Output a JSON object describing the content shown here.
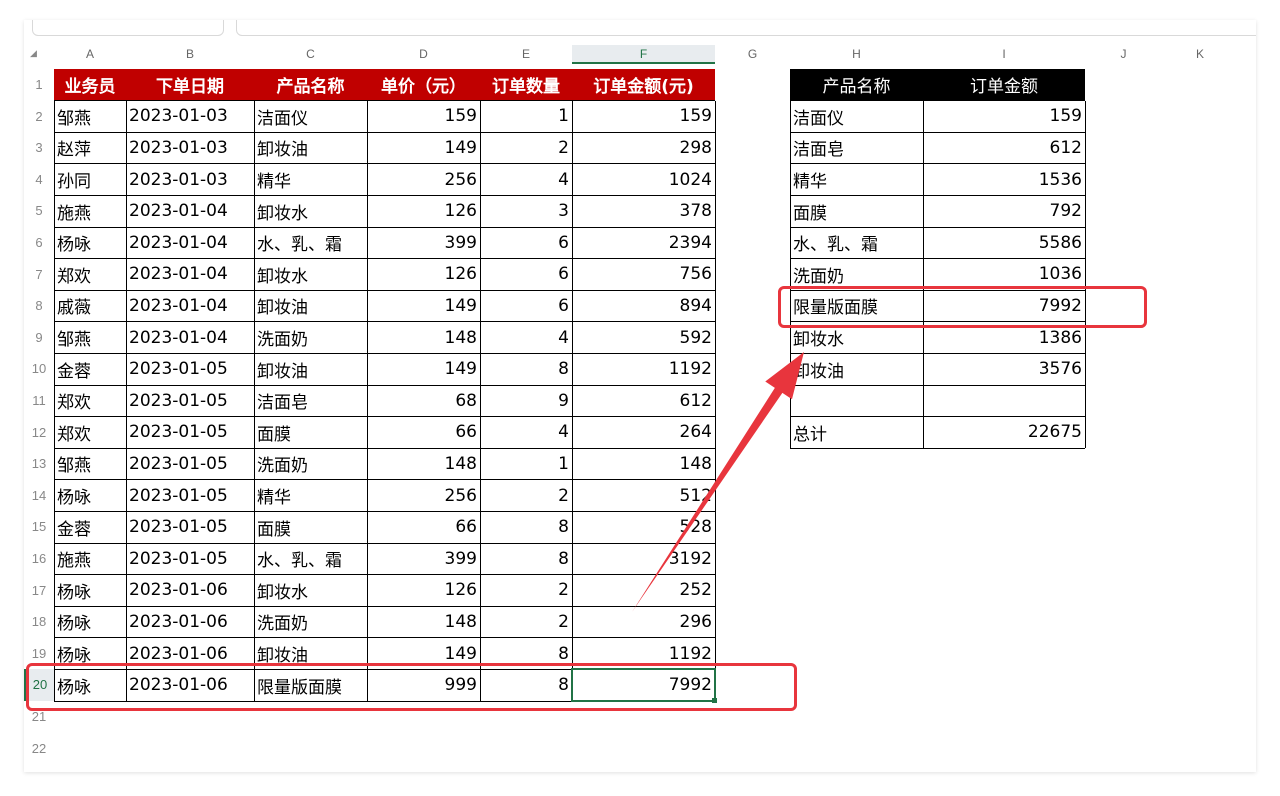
{
  "columns": [
    "A",
    "B",
    "C",
    "D",
    "E",
    "F",
    "G",
    "H",
    "I",
    "J",
    "K"
  ],
  "row_numbers": [
    "1",
    "2",
    "3",
    "4",
    "5",
    "6",
    "7",
    "8",
    "9",
    "10",
    "11",
    "12",
    "13",
    "14",
    "15",
    "16",
    "17",
    "18",
    "19",
    "20",
    "21",
    "22"
  ],
  "main_table": {
    "headers": [
      "业务员",
      "下单日期",
      "产品名称",
      "单价（元）",
      "订单数量",
      "订单金额(元)"
    ],
    "rows": [
      [
        "邹燕",
        "2023-01-03",
        "洁面仪",
        "159",
        "1",
        "159"
      ],
      [
        "赵萍",
        "2023-01-03",
        "卸妆油",
        "149",
        "2",
        "298"
      ],
      [
        "孙同",
        "2023-01-03",
        "精华",
        "256",
        "4",
        "1024"
      ],
      [
        "施燕",
        "2023-01-04",
        "卸妆水",
        "126",
        "3",
        "378"
      ],
      [
        "杨咏",
        "2023-01-04",
        "水、乳、霜",
        "399",
        "6",
        "2394"
      ],
      [
        "郑欢",
        "2023-01-04",
        "卸妆水",
        "126",
        "6",
        "756"
      ],
      [
        "戚薇",
        "2023-01-04",
        "卸妆油",
        "149",
        "6",
        "894"
      ],
      [
        "邹燕",
        "2023-01-04",
        "洗面奶",
        "148",
        "4",
        "592"
      ],
      [
        "金蓉",
        "2023-01-05",
        "卸妆油",
        "149",
        "8",
        "1192"
      ],
      [
        "郑欢",
        "2023-01-05",
        "洁面皂",
        "68",
        "9",
        "612"
      ],
      [
        "郑欢",
        "2023-01-05",
        "面膜",
        "66",
        "4",
        "264"
      ],
      [
        "邹燕",
        "2023-01-05",
        "洗面奶",
        "148",
        "1",
        "148"
      ],
      [
        "杨咏",
        "2023-01-05",
        "精华",
        "256",
        "2",
        "512"
      ],
      [
        "金蓉",
        "2023-01-05",
        "面膜",
        "66",
        "8",
        "528"
      ],
      [
        "施燕",
        "2023-01-05",
        "水、乳、霜",
        "399",
        "8",
        "3192"
      ],
      [
        "杨咏",
        "2023-01-06",
        "卸妆水",
        "126",
        "2",
        "252"
      ],
      [
        "杨咏",
        "2023-01-06",
        "洗面奶",
        "148",
        "2",
        "296"
      ],
      [
        "杨咏",
        "2023-01-06",
        "卸妆油",
        "149",
        "8",
        "1192"
      ],
      [
        "杨咏",
        "2023-01-06",
        "限量版面膜",
        "999",
        "8",
        "7992"
      ]
    ]
  },
  "summary_table": {
    "headers": [
      "产品名称",
      "订单金额"
    ],
    "rows": [
      [
        "洁面仪",
        "159"
      ],
      [
        "洁面皂",
        "612"
      ],
      [
        "精华",
        "1536"
      ],
      [
        "面膜",
        "792"
      ],
      [
        "水、乳、霜",
        "5586"
      ],
      [
        "洗面奶",
        "1036"
      ],
      [
        "限量版面膜",
        "7992"
      ],
      [
        "卸妆水",
        "1386"
      ],
      [
        "卸妆油",
        "3576"
      ],
      [
        "",
        ""
      ],
      [
        "总计",
        "22675"
      ]
    ]
  },
  "selection": {
    "cell": "F20",
    "active_column": "F",
    "active_row": "20"
  },
  "colors": {
    "header_red": "#c00000",
    "header_black": "#000000",
    "highlight": "#e8353d",
    "selection": "#217346"
  }
}
